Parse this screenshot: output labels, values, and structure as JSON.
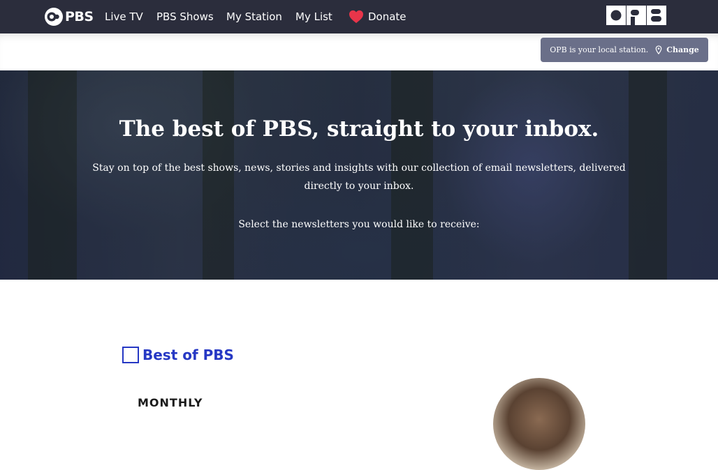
{
  "nav": {
    "logo_text": "PBS",
    "items": [
      {
        "label": "Live TV"
      },
      {
        "label": "PBS Shows"
      },
      {
        "label": "My Station"
      },
      {
        "label": "My List"
      }
    ],
    "donate_label": "Donate",
    "donate_icon": "heart-icon",
    "donate_icon_color": "#e8354a",
    "station_logo": "OPB"
  },
  "station": {
    "message": "OPB is your local station.",
    "change_label": "Change",
    "icon": "map-pin-icon"
  },
  "hero": {
    "title": "The best of PBS, straight to your inbox.",
    "description": "Stay on top of the best shows, news, stories and insights with our collection of email newsletters, delivered directly to your inbox.",
    "select_prompt": "Select the newsletters you would like to receive:"
  },
  "newsletters": [
    {
      "title": "Best of PBS",
      "frequency": "MONTHLY",
      "checked": false
    }
  ],
  "colors": {
    "nav_bg": "#2b2d3c",
    "accent": "#2638c4",
    "station_pill": "#6a6f89"
  }
}
